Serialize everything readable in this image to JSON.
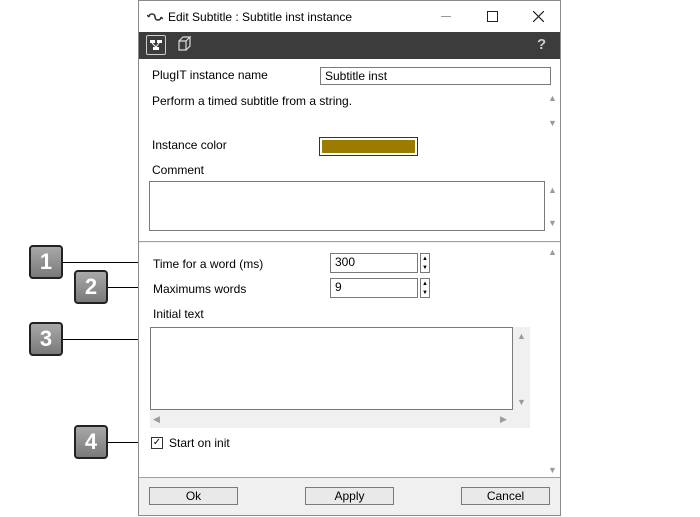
{
  "window": {
    "title": "Edit Subtitle : Subtitle inst instance",
    "minimize_icon": "minimize-icon",
    "maximize_icon": "maximize-icon",
    "close_icon": "close-icon"
  },
  "toolbar": {
    "icons": [
      "graph-icon",
      "cube-icon",
      "help-icon"
    ],
    "help_glyph": "?"
  },
  "instance": {
    "name_label": "PlugIT instance name",
    "name_value": "Subtitle inst",
    "description": "Perform a timed subtitle from a string.",
    "color_label": "Instance color",
    "color_value": "#9b7b00",
    "comment_label": "Comment",
    "comment_value": ""
  },
  "params": {
    "time_label": "Time for a word (ms)",
    "time_value": "300",
    "max_label": "Maximums words",
    "max_value": "9",
    "initial_label": "Initial text",
    "initial_value": "",
    "start_label": "Start on init",
    "start_checked": true
  },
  "buttons": {
    "ok": "Ok",
    "apply": "Apply",
    "cancel": "Cancel"
  },
  "callouts": [
    "1",
    "2",
    "3",
    "4"
  ]
}
